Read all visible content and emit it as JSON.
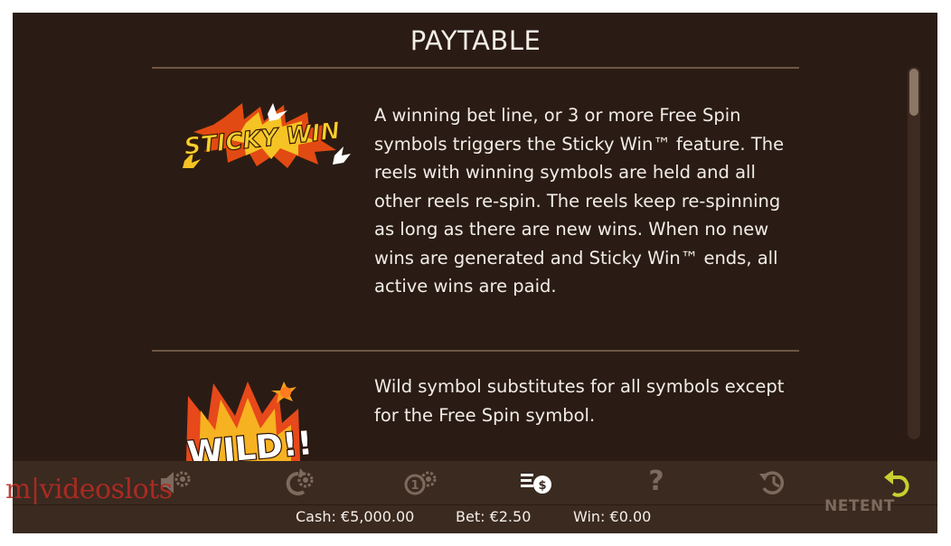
{
  "header": {
    "title": "PAYTABLE"
  },
  "items": [
    {
      "symbol_text": "STICKY WIN",
      "description": "A winning bet line, or 3 or more Free Spin symbols triggers the Sticky Win™ feature. The reels with winning symbols are held and all other reels re-spin. The reels keep re-spinning as long as there are new wins. When no new wins are generated and Sticky Win™ ends, all active wins are paid."
    },
    {
      "symbol_text": "WILD!!",
      "description": "Wild symbol substitutes for all symbols except for the Free Spin symbol."
    }
  ],
  "controls": [
    {
      "name": "sound-settings",
      "icon": "speaker-gear-icon"
    },
    {
      "name": "autoplay-settings",
      "icon": "autoplay-gear-icon"
    },
    {
      "name": "coin-settings",
      "icon": "coins-gear-icon"
    },
    {
      "name": "paytable",
      "icon": "paytable-coin-icon"
    },
    {
      "name": "help",
      "icon": "question-icon",
      "label": "?"
    },
    {
      "name": "history",
      "icon": "history-clock-icon"
    },
    {
      "name": "back",
      "icon": "back-arrow-icon"
    }
  ],
  "status": {
    "cash": "Cash: €5,000.00",
    "bet": "Bet: €2.50",
    "win": "Win: €0.00"
  },
  "watermark": "m|videoslots",
  "provider": "NETENT",
  "colors": {
    "background": "#2a1c14",
    "bar": "#3a2a20",
    "accent_back": "#c7d12e",
    "watermark": "#b72a24"
  }
}
